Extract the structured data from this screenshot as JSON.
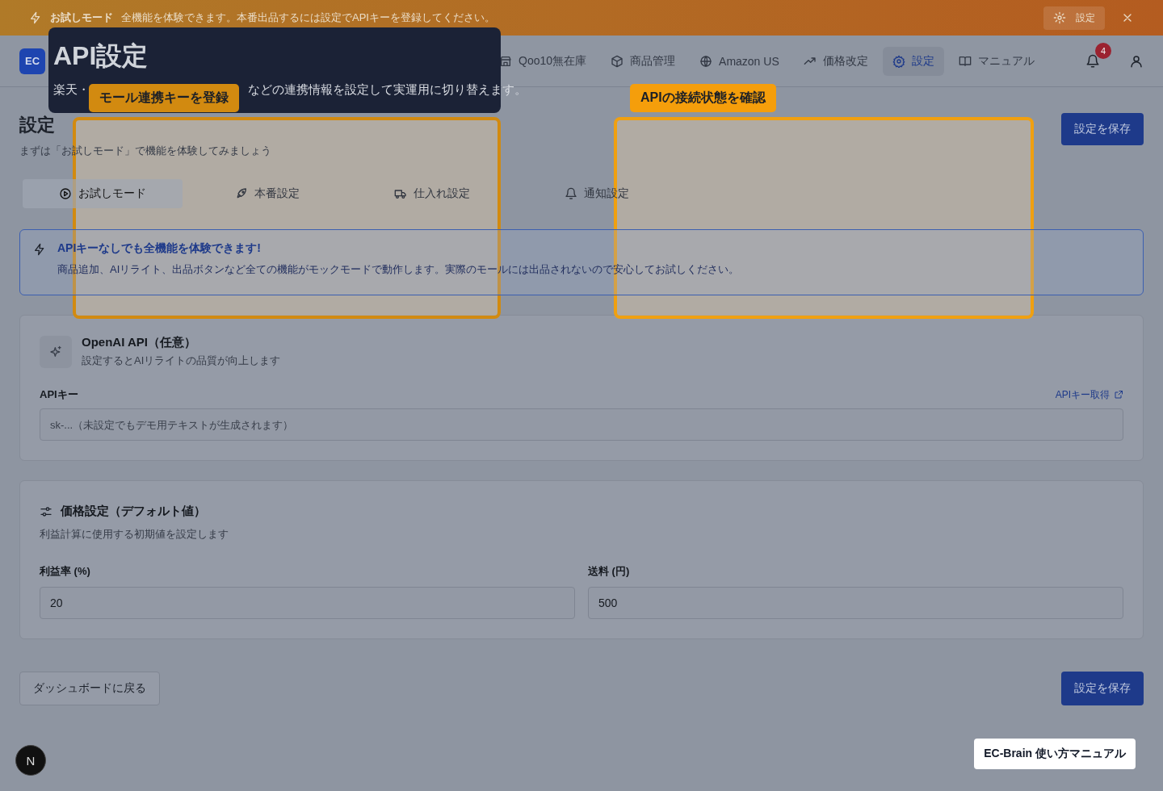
{
  "trial_banner": {
    "title": "お試しモード",
    "message": "全機能を体験できます。本番出品するには設定でAPIキーを登録してください。",
    "settings_button": "設定"
  },
  "logo": "EC",
  "nav": [
    {
      "label": "Qoo10無在庫",
      "selected": false
    },
    {
      "label": "商品管理",
      "selected": false
    },
    {
      "label": "Amazon US",
      "selected": false
    },
    {
      "label": "価格改定",
      "selected": false
    },
    {
      "label": "設定",
      "selected": true
    },
    {
      "label": "マニュアル",
      "selected": false
    }
  ],
  "notifications": {
    "count": "4"
  },
  "page": {
    "title": "設定",
    "subtitle": "まずは「お試しモード」で機能を体験してみましょう",
    "save_button": "設定を保存"
  },
  "tabs": [
    {
      "label": "お試しモード",
      "selected": true
    },
    {
      "label": "本番設定",
      "selected": false
    },
    {
      "label": "仕入れ設定",
      "selected": false
    },
    {
      "label": "通知設定",
      "selected": false
    }
  ],
  "info": {
    "title": "APIキーなしでも全機能を体験できます!",
    "body": "商品追加、AIリライト、出品ボタンなど全ての機能がモックモードで動作します。実際のモールには出品されないので安心してお試しください。"
  },
  "openai_card": {
    "title": "OpenAI API（任意）",
    "subtitle": "設定するとAIリライトの品質が向上します",
    "field_label": "APIキー",
    "link": "APIキー取得",
    "placeholder": "sk-...（未設定でもデモ用テキストが生成されます）"
  },
  "price_card": {
    "title": "価格設定（デフォルト値）",
    "subtitle": "利益計算に使用する初期値を設定します",
    "fields": [
      {
        "label": "利益率 (%)",
        "value": "20"
      },
      {
        "label": "送料 (円)",
        "value": "500"
      }
    ]
  },
  "footer": {
    "back_button": "ダッシュボードに戻る",
    "save_button": "設定を保存"
  },
  "dev_indicator": "N",
  "manual_button": "EC-Brain 使い方マニュアル",
  "tour": {
    "title": "API設定",
    "description_parts": [
      "楽天・",
      "などの連携情報を設定して実運用に切り替えます。"
    ],
    "highlights": [
      {
        "label": "モール連携キーを登録"
      },
      {
        "label": "APIの接続状態を確認"
      }
    ]
  }
}
